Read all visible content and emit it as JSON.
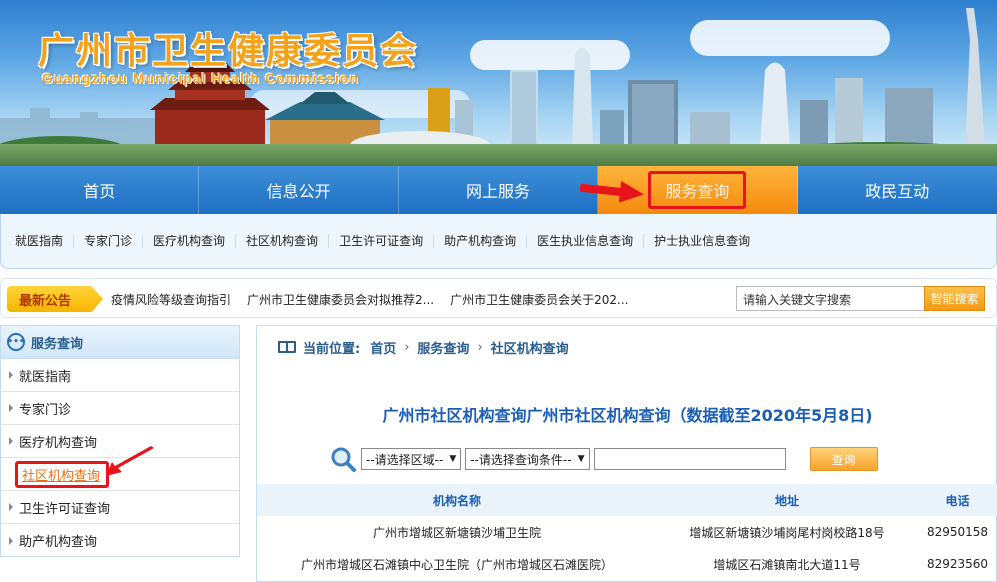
{
  "banner": {
    "title_cn": "广州市卫生健康委员会",
    "title_en": "Guangzhou Municipal Health Commission"
  },
  "mainnav": {
    "items": [
      "首页",
      "信息公开",
      "网上服务",
      "服务查询",
      "政民互动"
    ],
    "active": "服务查询"
  },
  "subnav": {
    "items": [
      "就医指南",
      "专家门诊",
      "医疗机构查询",
      "社区机构查询",
      "卫生许可证查询",
      "助产机构查询",
      "医生执业信息查询",
      "护士执业信息查询"
    ]
  },
  "notice": {
    "label": "最新公告",
    "items": [
      "疫情风险等级查询指引",
      "广州市卫生健康委员会对拟推荐2...",
      "广州市卫生健康委员会关于202..."
    ]
  },
  "search": {
    "placeholder": "请输入关键文字搜索",
    "button": "智能搜索"
  },
  "sidebar": {
    "title": "服务查询",
    "items": [
      "就医指南",
      "专家门诊",
      "医疗机构查询",
      "社区机构查询",
      "卫生许可证查询",
      "助产机构查询"
    ],
    "active": "社区机构查询"
  },
  "breadcrumb": {
    "label": "当前位置:",
    "items": [
      "首页",
      "服务查询",
      "社区机构查询"
    ]
  },
  "content": {
    "title": "广州市社区机构查询广州市社区机构查询（数据截至2020年5月8日)",
    "region_select": "--请选择区域--",
    "condition_select": "--请选择查询条件--",
    "query_button": "查询"
  },
  "table": {
    "headers": [
      "机构名称",
      "地址",
      "电话"
    ],
    "rows": [
      [
        "广州市增城区新塘镇沙埔卫生院",
        "增城区新塘镇沙埔岗尾村岗校路18号",
        "82950158"
      ],
      [
        "广州市增城区石滩镇中心卫生院（广州市增城区石滩医院）",
        "增城区石滩镇南北大道11号",
        "82923560"
      ]
    ]
  },
  "colors": {
    "nav_blue": "#1e6fc2",
    "active_orange": "#f48a0e",
    "highlight_red": "#e8141c",
    "title_orange": "#f4a21c"
  }
}
